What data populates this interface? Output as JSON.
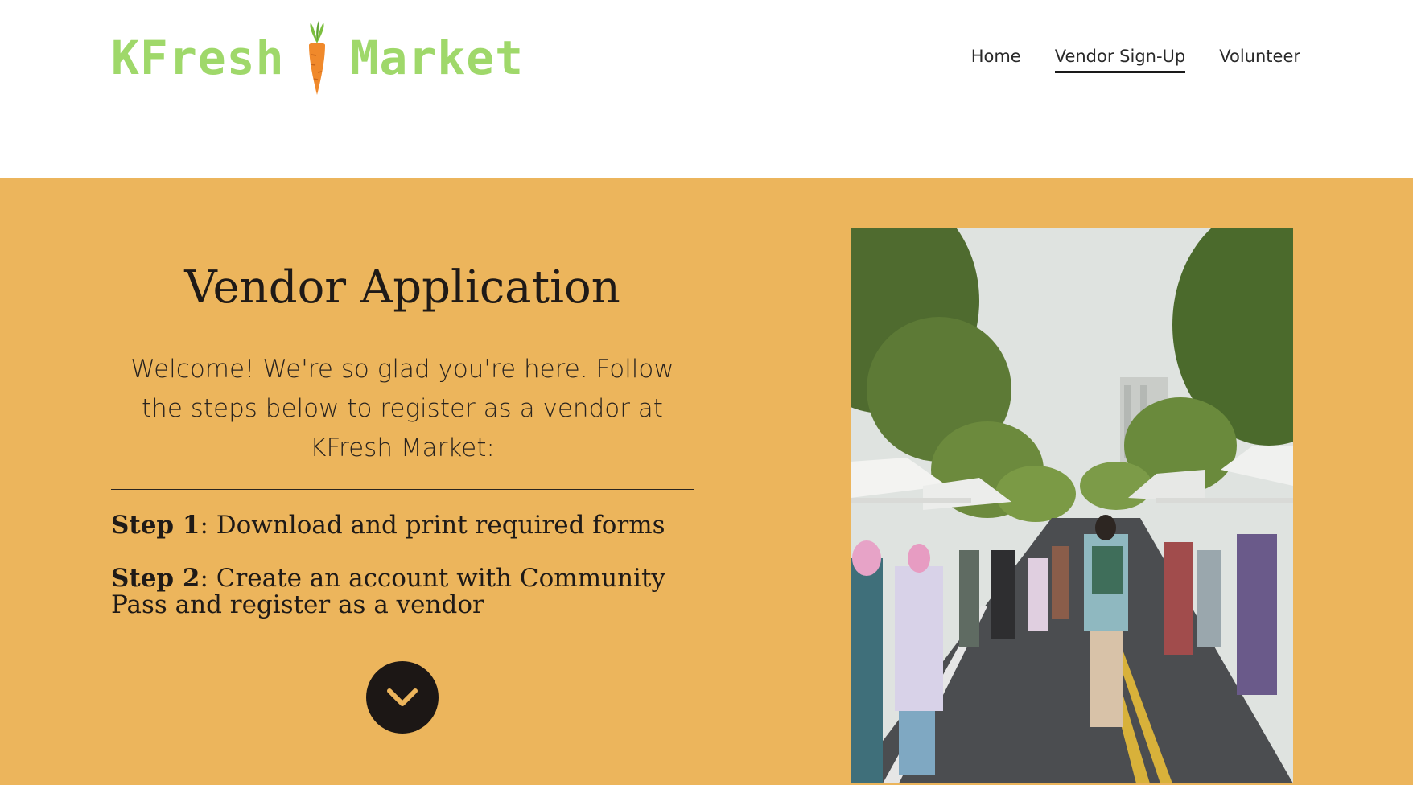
{
  "site": {
    "logo_text_left": "KFresh",
    "logo_text_right": "Market",
    "logo_icon": "carrot-icon",
    "logo_color": "#9fd86a",
    "carrot_color": "#f0892b"
  },
  "nav": {
    "items": [
      {
        "label": "Home",
        "active": false
      },
      {
        "label": "Vendor Sign-Up",
        "active": true
      },
      {
        "label": "Volunteer",
        "active": false
      }
    ]
  },
  "hero": {
    "background": "#ecb55c",
    "title": "Vendor Application",
    "welcome": "Welcome! We're so glad you're here.  Follow the steps below to register as a vendor at KFresh Market:",
    "steps": [
      {
        "label": "Step 1",
        "text": ": Download and print required forms"
      },
      {
        "label": "Step 2",
        "text": ": Create an account with Community Pass and register as a vendor"
      }
    ],
    "scroll_icon": "chevron-down-icon",
    "photo_icon": "street-market-photo"
  }
}
